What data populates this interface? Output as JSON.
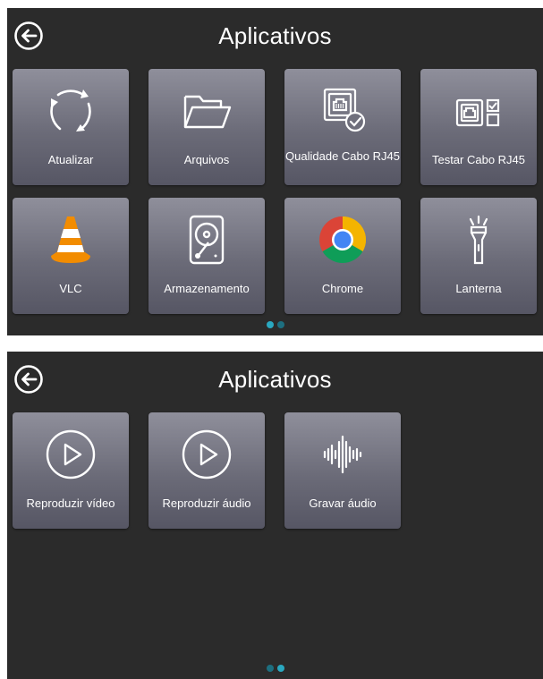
{
  "screen1": {
    "title": "Aplicativos",
    "apps": [
      {
        "label": "Atualizar",
        "icon": "refresh-icon"
      },
      {
        "label": "Arquivos",
        "icon": "folder-icon"
      },
      {
        "label": "Qualidade Cabo RJ45",
        "icon": "ethernet-quality-icon"
      },
      {
        "label": "Testar Cabo RJ45",
        "icon": "ethernet-test-icon"
      },
      {
        "label": "VLC",
        "icon": "vlc-cone-icon"
      },
      {
        "label": "Armazenamento",
        "icon": "hard-drive-icon"
      },
      {
        "label": "Chrome",
        "icon": "chrome-icon"
      },
      {
        "label": "Lanterna",
        "icon": "flashlight-icon"
      }
    ],
    "page_indicator": {
      "pages": 2,
      "current": 1
    }
  },
  "screen2": {
    "title": "Aplicativos",
    "apps": [
      {
        "label": "Reproduzir vídeo",
        "icon": "play-circle-icon"
      },
      {
        "label": "Reproduzir áudio",
        "icon": "play-circle-icon"
      },
      {
        "label": "Gravar áudio",
        "icon": "audio-waveform-icon"
      }
    ],
    "page_indicator": {
      "pages": 2,
      "current": 2
    }
  },
  "colors": {
    "background": "#2b2b2b",
    "tile_top": "#8f8f9b",
    "tile_bottom": "#565664",
    "dot_accent": "#2aa8c0",
    "chrome_red": "#db4437",
    "chrome_green": "#0f9d58",
    "chrome_yellow": "#f4b400",
    "chrome_blue": "#4285f4",
    "vlc_orange": "#f28c00"
  }
}
